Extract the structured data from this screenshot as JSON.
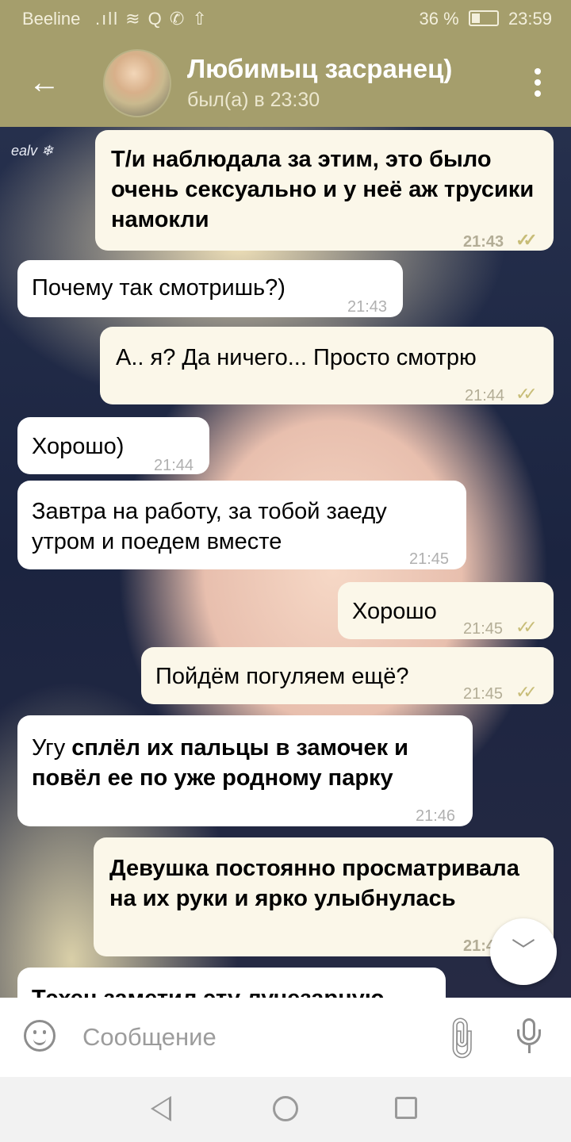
{
  "status_bar": {
    "carrier": "Beeline",
    "icons": ".ıll ≋ Q ✆ ⇧",
    "battery": "36 %",
    "time": "23:59"
  },
  "header": {
    "title": "Любимыц засранец)",
    "subtitle": "был(а) в 23:30"
  },
  "chat": {
    "watermark": "ealv ❄",
    "messages": [
      {
        "side": "out",
        "text": "Т/и наблюдала за этим, это было очень сексуально и у неё аж трусики намокли",
        "time": "21:43",
        "read": "✓✓"
      },
      {
        "side": "in",
        "text": "Почему так смотришь?)",
        "time": "21:43"
      },
      {
        "side": "out",
        "text": "А.. я? Да ничего... Просто смотрю",
        "time": "21:44",
        "read": "✓✓"
      },
      {
        "side": "in",
        "text": "Хорошо)",
        "time": "21:44"
      },
      {
        "side": "in",
        "text": "Завтра на работу, за тобой заеду утром и поедем вместе",
        "time": "21:45"
      },
      {
        "side": "out",
        "text": "Хорошо",
        "time": "21:45",
        "read": "✓✓"
      },
      {
        "side": "out",
        "text": "Пойдём погуляем ещё?",
        "time": "21:45",
        "read": "✓✓"
      },
      {
        "side": "in",
        "text_plain": "Угу",
        "text_bold": "сплёл их пальцы в замочек и повёл ее по уже родному парку",
        "time": "21:46"
      },
      {
        "side": "out",
        "text": "Девушка постоянно просматривала на их руки и ярко улыбнулась",
        "time": "21:4"
      },
      {
        "side": "in",
        "text": "Тэхен заметил эту лучезарную"
      }
    ]
  },
  "scroll_button_icon": "chevron-down-icon",
  "input_bar": {
    "placeholder": "Сообщение"
  },
  "colors": {
    "header": "#a59e6c",
    "outgoing_bubble": "#fbf7e9",
    "incoming_bubble": "#ffffff",
    "read_check": "#c8bd78"
  }
}
